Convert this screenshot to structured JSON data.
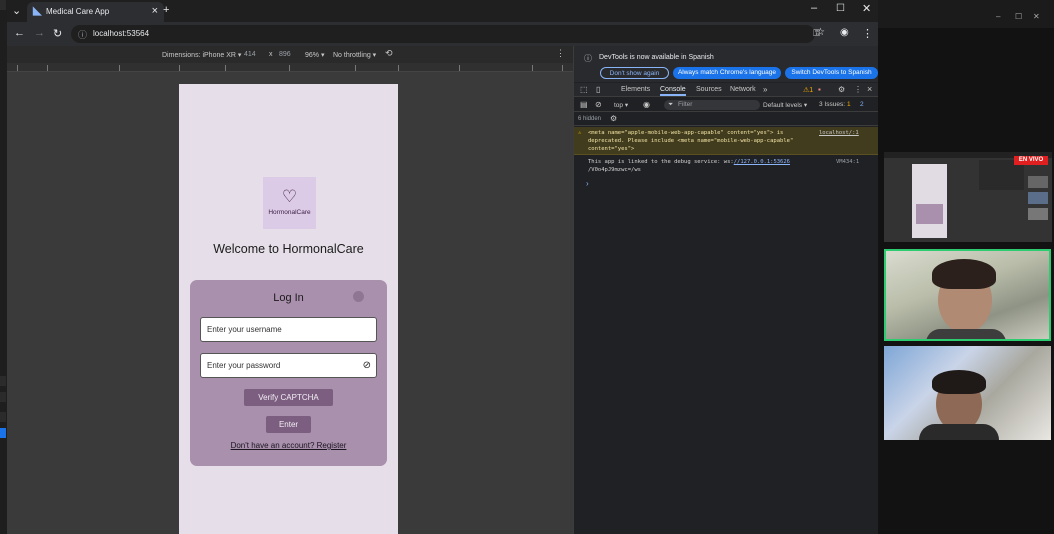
{
  "browser": {
    "tab_title": "Medical Care App",
    "url": "localhost:53564",
    "new_tab_label": "+"
  },
  "device_toolbar": {
    "dimensions_label": "Dimensions: iPhone XR ▾",
    "width": "414",
    "x": "x",
    "height": "896",
    "zoom": "96% ▾",
    "throttling": "No throttling ▾"
  },
  "app": {
    "logo_text": "HormonalCare",
    "welcome": "Welcome to HormonalCare",
    "login_title": "Log In",
    "username_placeholder": "Enter your username",
    "password_placeholder": "Enter your password",
    "captcha_button": "Verify CAPTCHA",
    "enter_button": "Enter",
    "register_link": "Don't have an account? Register"
  },
  "devtools": {
    "banner_text": "DevTools is now available in Spanish",
    "dont_show": "Don't show again",
    "match_language": "Always match Chrome's language",
    "switch_spanish": "Switch DevTools to Spanish",
    "tabs": [
      "Elements",
      "Console",
      "Sources",
      "Network"
    ],
    "more": "»",
    "warnings_count": "1",
    "context": "top ▾",
    "filter_placeholder": "Filter",
    "levels": "Default levels ▾",
    "issues": "3 Issues:",
    "issues_warn": "1",
    "issues_info": "2",
    "hidden": "6 hidden",
    "warning_message": "<meta name=\"apple-mobile-web-app-capable\" content=\"yes\"> is deprecated. Please include <meta name=\"mobile-web-app-capable\" content=\"yes\">",
    "warning_source": "localhost/:1",
    "info_prefix": "This app is linked to the debug service: ws:",
    "info_link": "//127.0.0.1:53626",
    "info_suffix": "/V0o4pJ9mzwc=/ws",
    "info_source": "VM434:1",
    "prompt": "›"
  },
  "stream": {
    "live_label": "EN VIVO"
  },
  "colors": {
    "accent_blue": "#1a73e8",
    "app_card": "#a990ad",
    "app_button": "#7b5e80",
    "live_red": "#e02020",
    "speaker_border": "#2ecc71"
  }
}
